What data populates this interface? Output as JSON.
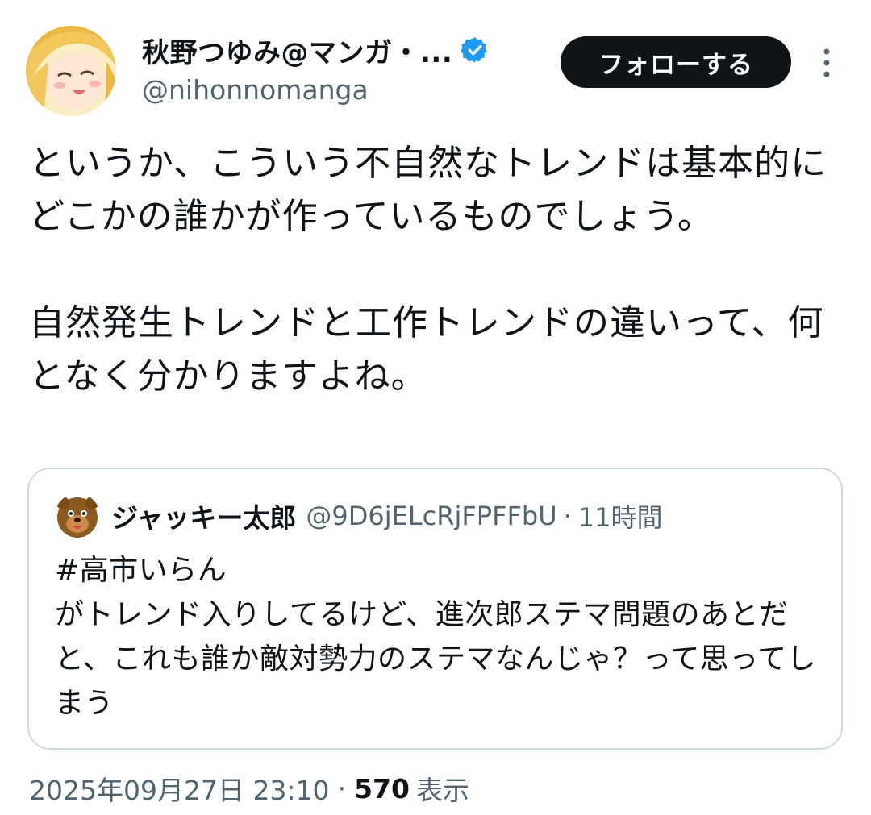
{
  "author": {
    "display_name": "秋野つゆみ@マンガ・...",
    "handle": "@nihonnomanga",
    "verified_icon": "verified-badge-icon",
    "accent_color": "#1d9bf0"
  },
  "actions": {
    "follow_label": "フォローする",
    "more_icon": "more-vertical-icon"
  },
  "tweet": {
    "text": "というか、こういう不自然なトレンドは基本的にどこかの誰かが作っているものでしょう。\n\n自然発生トレンドと工作トレンドの違いって、何となく分かりますよね。"
  },
  "quote": {
    "display_name": "ジャッキー太郎",
    "handle": "@9D6jELcRjFPFFbU",
    "separator": "·",
    "time": "11時間",
    "text": "#高市いらん\nがトレンド入りしてるけど、進次郎ステマ問題のあとだと、これも誰か敵対勢力のステマなんじゃ？って思ってしまう"
  },
  "meta": {
    "timestamp": "2025年09月27日 23:10",
    "separator": "·",
    "views_count": "570",
    "views_label": "表示"
  }
}
